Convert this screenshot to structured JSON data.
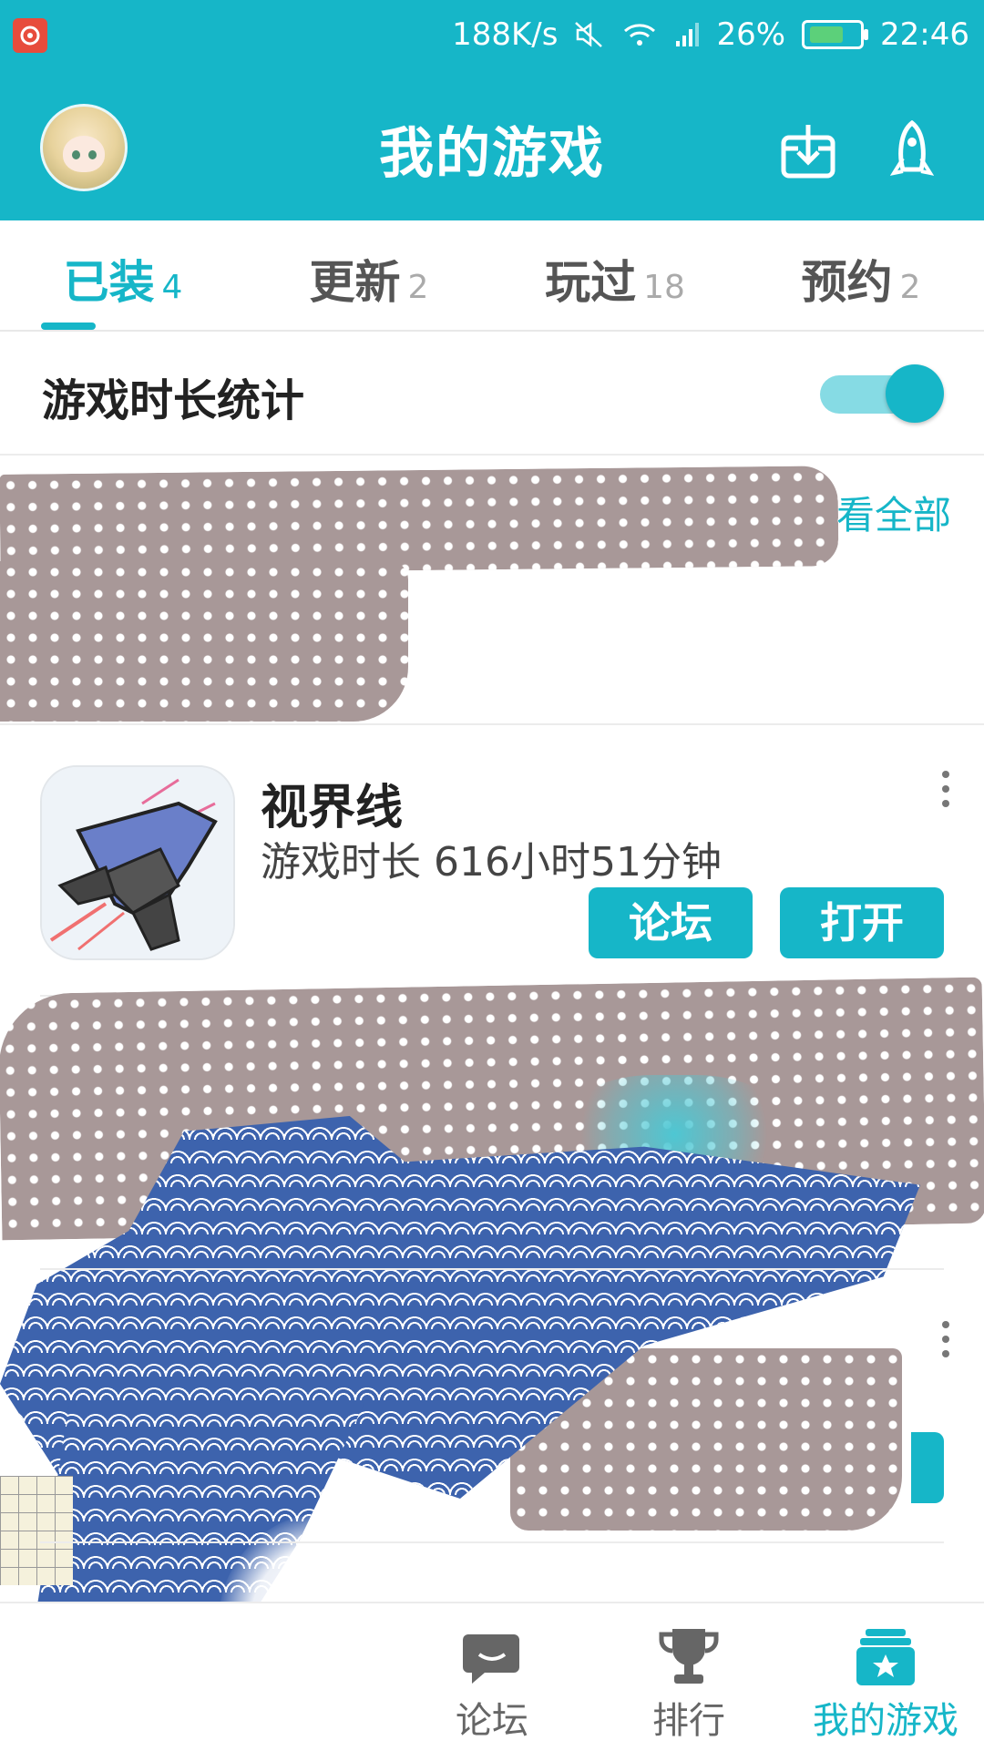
{
  "status_bar": {
    "speed": "188K/s",
    "battery_pct": "26%",
    "time": "22:46"
  },
  "header": {
    "title": "我的游戏"
  },
  "tabs": [
    {
      "label": "已装",
      "count": "4",
      "active": true
    },
    {
      "label": "更新",
      "count": "2",
      "active": false
    },
    {
      "label": "玩过",
      "count": "18",
      "active": false
    },
    {
      "label": "预约",
      "count": "2",
      "active": false
    }
  ],
  "stats": {
    "label": "游戏时长统计",
    "enabled": true
  },
  "view_all": "看全部",
  "games": [
    {
      "name": "视界线",
      "playtime": "游戏时长 616小时51分钟",
      "forum_label": "论坛",
      "open_label": "打开"
    }
  ],
  "bottom_nav": [
    {
      "label": "论坛",
      "icon": "chat-icon",
      "active": false
    },
    {
      "label": "排行",
      "icon": "trophy-icon",
      "active": false
    },
    {
      "label": "我的游戏",
      "icon": "my-games-icon",
      "active": true
    }
  ],
  "colors": {
    "accent": "#16b6c8",
    "toggle_track": "#86dbe4"
  }
}
